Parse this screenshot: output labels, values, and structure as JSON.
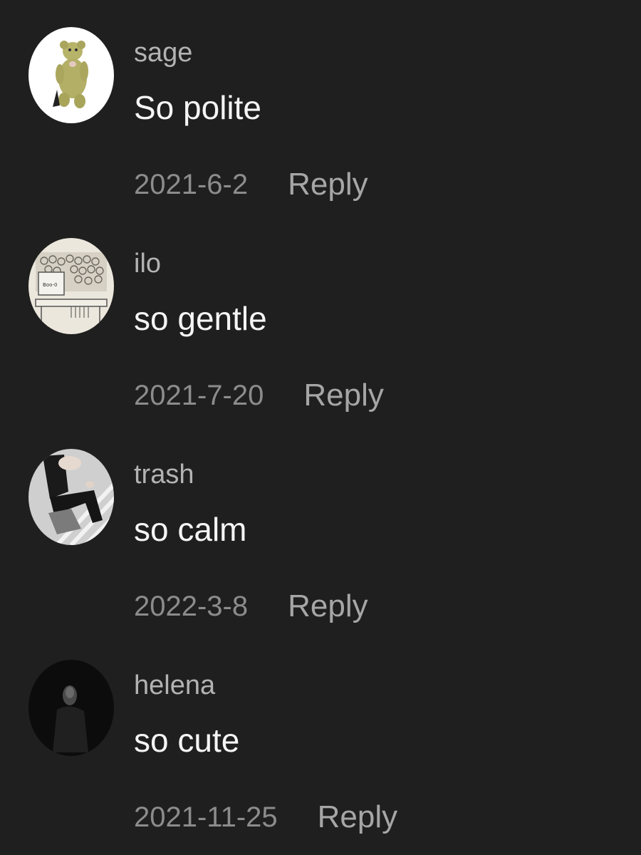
{
  "comments": [
    {
      "username": "sage",
      "text": "So polite",
      "date": "2021-6-2",
      "reply_label": "Reply",
      "avatar_icon": "teddy-bear-avatar"
    },
    {
      "username": "ilo",
      "text": "so gentle",
      "date": "2021-7-20",
      "reply_label": "Reply",
      "avatar_icon": "cartoon-box-avatar"
    },
    {
      "username": "trash",
      "text": "so calm",
      "date": "2022-3-8",
      "reply_label": "Reply",
      "avatar_icon": "sitting-person-avatar"
    },
    {
      "username": "helena",
      "text": "so cute",
      "date": "2021-11-25",
      "reply_label": "Reply",
      "avatar_icon": "dark-portrait-avatar"
    }
  ],
  "colors": {
    "background": "#1f1f1f",
    "username": "#b3b3b3",
    "comment_text": "#f5f5f5",
    "date": "#8c8c8c",
    "reply": "#a6a6a6"
  }
}
